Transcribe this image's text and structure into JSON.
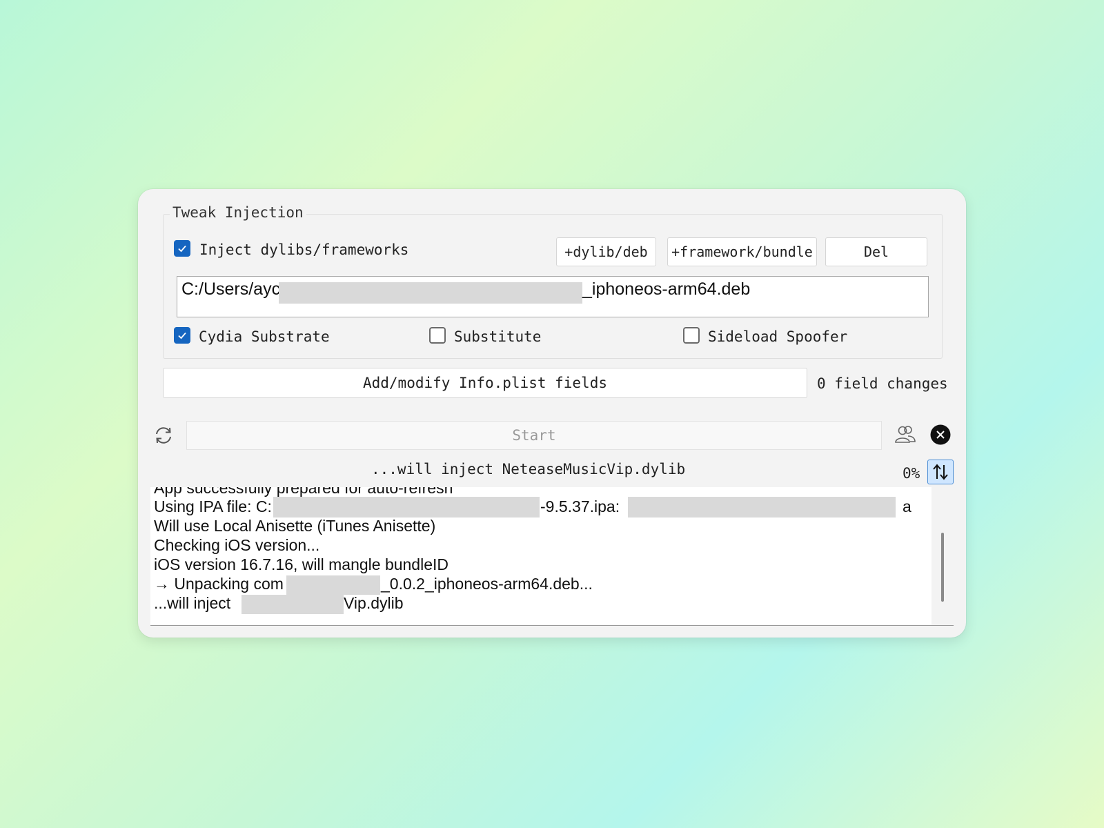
{
  "tweak_injection": {
    "group_title": "Tweak Injection",
    "inject_checkbox": {
      "label": "Inject dylibs/frameworks",
      "checked": true
    },
    "buttons": {
      "add_dylib": "+dylib/deb",
      "add_framework": "+framework/bundle",
      "delete": "Del"
    },
    "file_path": {
      "prefix": "C:/Users/ayc",
      "suffix": "_iphoneos-arm64.deb"
    },
    "options": {
      "cydia_substrate": {
        "label": "Cydia Substrate",
        "checked": true
      },
      "substitute": {
        "label": "Substitute",
        "checked": false
      },
      "sideload_spoofer": {
        "label": "Sideload Spoofer",
        "checked": false
      }
    }
  },
  "plist": {
    "button_label": "Add/modify Info.plist fields",
    "changes_text": "0 field changes"
  },
  "actions": {
    "start_label": "Start",
    "status_text": "...will inject NeteaseMusicVip.dylib",
    "progress_percent": "0%"
  },
  "icons": {
    "refresh": "refresh-icon",
    "users": "users-icon",
    "close": "close-icon",
    "sort": "sort-arrows-icon"
  },
  "log": {
    "line0": "App successfully prepared for auto-refresh",
    "line1": {
      "part1": "Using IPA file: C:",
      "part2": "-9.5.37.ipa: ",
      "part3": "a"
    },
    "line2": "Will use Local Anisette (iTunes Anisette)",
    "line3": "Checking iOS version...",
    "line4": "iOS version 16.7.16, will mangle bundleID",
    "line5": {
      "part1": "→ Unpacking com",
      "part2": "_0.0.2_iphoneos-arm64.deb..."
    },
    "line6": {
      "part1": " ...will inject ",
      "part2": "Vip.dylib"
    }
  },
  "colors": {
    "accent": "#1565c0",
    "sort_button_bg": "#cfe6ff",
    "window_bg": "#f3f3f3"
  }
}
